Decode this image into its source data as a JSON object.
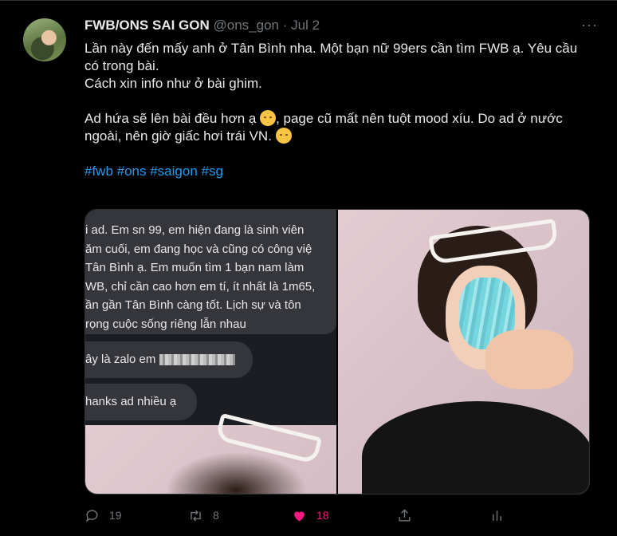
{
  "tweet": {
    "name": "FWB/ONS SAI GON",
    "handle": "@ons_gon",
    "separator": "·",
    "date": "Jul 2",
    "more": "···",
    "line1": "Lần này đến mấy anh ở Tân Bình nha. Một bạn nữ 99ers cần tìm FWB ạ. Yêu cầu có trong bài.",
    "line2": "Cách xin info như ở bài ghim.",
    "line3a": "Ad hứa sẽ lên bài đều hơn ạ ",
    "line3b": ", page cũ mất nên tuột mood xíu. Do ad ở nước ngoài, nên giờ giấc hơi trái VN. ",
    "hashtags": "#fwb #ons #saigon #sg"
  },
  "media": {
    "chat_lines": [
      "i ad. Em sn 99, em hiện đang là sinh viên",
      "ăm cuối, em đang học và cũng có công việ",
      " Tân Bình ạ. Em muốn tìm 1 bạn nam làm",
      "WB, chỉ cần cao hơn em tí, ít nhất là 1m65,",
      "ần gần Tân Bình càng tốt. Lịch sự và tôn",
      "rọng cuộc sống riêng lẫn nhau"
    ],
    "bubble1": "ây là zalo em",
    "bubble2": "hanks ad nhiều ạ"
  },
  "actions": {
    "replies": "19",
    "retweets": "8",
    "likes": "18",
    "reply_icon": "reply-icon",
    "retweet_icon": "retweet-icon",
    "like_icon": "heart-icon",
    "share_icon": "share-icon",
    "analytics_icon": "analytics-icon",
    "like_color": "#f91880",
    "hashtag_color": "#1d9bf0"
  }
}
